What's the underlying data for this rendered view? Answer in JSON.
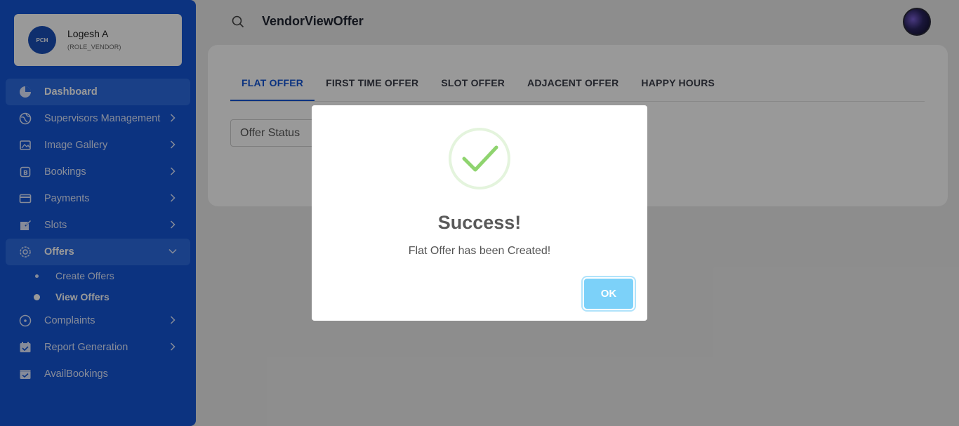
{
  "profile": {
    "name": "Logesh A",
    "role": "(ROLE_VENDOR)",
    "logo_text": "PCH"
  },
  "sidebar": {
    "items": [
      {
        "label": "Dashboard",
        "icon": "pie-chart-icon",
        "active": true
      },
      {
        "label": "Supervisors Management",
        "icon": "globe-icon"
      },
      {
        "label": "Image Gallery",
        "icon": "image-icon"
      },
      {
        "label": "Bookings",
        "icon": "booking-icon"
      },
      {
        "label": "Payments",
        "icon": "card-icon"
      },
      {
        "label": "Slots",
        "icon": "edit-icon"
      },
      {
        "label": "Offers",
        "icon": "gear-icon",
        "expanded": true
      },
      {
        "label": "Complaints",
        "icon": "circle-dot-icon"
      },
      {
        "label": "Report Generation",
        "icon": "calendar-check-icon"
      },
      {
        "label": "AvailBookings",
        "icon": "calendar-icon"
      }
    ],
    "offers_sub": [
      {
        "label": "Create Offers"
      },
      {
        "label": "View Offers",
        "current": true
      }
    ]
  },
  "header": {
    "title": "VendorViewOffer"
  },
  "tabs": [
    {
      "label": "FLAT OFFER",
      "active": true
    },
    {
      "label": "FIRST TIME OFFER"
    },
    {
      "label": "SLOT OFFER"
    },
    {
      "label": "ADJACENT OFFER"
    },
    {
      "label": "HAPPY HOURS"
    }
  ],
  "filter": {
    "placeholder": "Offer Status"
  },
  "modal": {
    "title": "Success!",
    "message": "Flat Offer has been Created!",
    "ok_label": "OK"
  },
  "colors": {
    "sidebar": "#1556d6",
    "accent": "#1556d6",
    "success": "#8fd46f",
    "ok_button": "#7cd1f9"
  }
}
